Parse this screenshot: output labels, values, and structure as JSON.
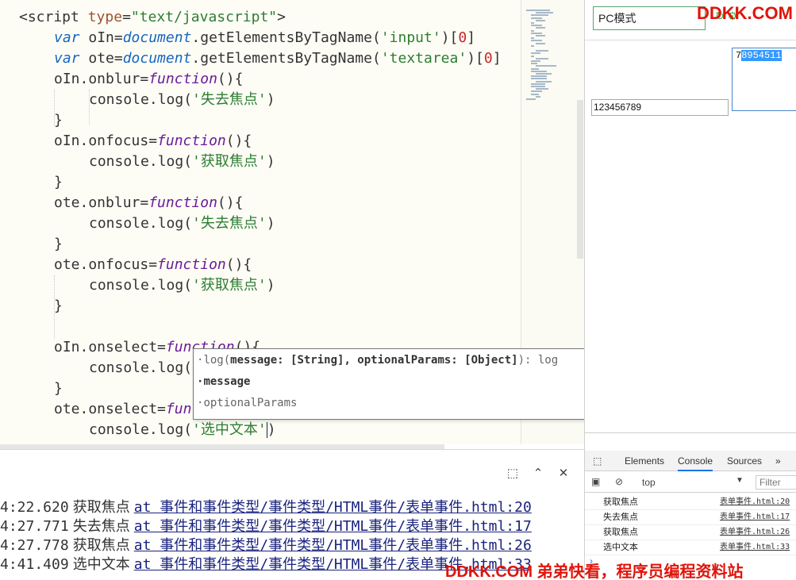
{
  "editor": {
    "lines": [
      [
        [
          "tag",
          "<script "
        ],
        [
          "attr",
          "type"
        ],
        [
          "tag",
          "="
        ],
        [
          "str",
          "\"text/javascript\""
        ],
        [
          "tag",
          ">"
        ]
      ],
      [
        [
          "var",
          "var"
        ],
        [
          "id",
          " oIn="
        ],
        [
          "obj",
          "document"
        ],
        [
          "id",
          ".getElementsByTagName("
        ],
        [
          "str",
          "'input'"
        ],
        [
          "id",
          ")["
        ],
        [
          "num",
          "0"
        ],
        [
          "id",
          "]"
        ]
      ],
      [
        [
          "var",
          "var"
        ],
        [
          "id",
          " ote="
        ],
        [
          "obj",
          "document"
        ],
        [
          "id",
          ".getElementsByTagName("
        ],
        [
          "str",
          "'textarea'"
        ],
        [
          "id",
          ")["
        ],
        [
          "num",
          "0"
        ],
        [
          "id",
          "]"
        ]
      ],
      [
        [
          "id",
          "oIn.onblur="
        ],
        [
          "fn",
          "function"
        ],
        [
          "id",
          "(){"
        ]
      ],
      [
        [
          "id",
          "console.log("
        ],
        [
          "str",
          "'失去焦点'"
        ],
        [
          "id",
          ")"
        ]
      ],
      [
        [
          "id",
          "}"
        ]
      ],
      [
        [
          "id",
          "oIn.onfocus="
        ],
        [
          "fn",
          "function"
        ],
        [
          "id",
          "(){"
        ]
      ],
      [
        [
          "id",
          "console.log("
        ],
        [
          "str",
          "'获取焦点'"
        ],
        [
          "id",
          ")"
        ]
      ],
      [
        [
          "id",
          "}"
        ]
      ],
      [
        [
          "id",
          "ote.onblur="
        ],
        [
          "fn",
          "function"
        ],
        [
          "id",
          "(){"
        ]
      ],
      [
        [
          "id",
          "console.log("
        ],
        [
          "str",
          "'失去焦点'"
        ],
        [
          "id",
          ")"
        ]
      ],
      [
        [
          "id",
          "}"
        ]
      ],
      [
        [
          "id",
          "ote.onfocus="
        ],
        [
          "fn",
          "function"
        ],
        [
          "id",
          "(){"
        ]
      ],
      [
        [
          "id",
          "console.log("
        ],
        [
          "str",
          "'获取焦点'"
        ],
        [
          "id",
          ")"
        ]
      ],
      [
        [
          "id",
          "}"
        ]
      ],
      [],
      [
        [
          "id",
          "oIn.onselect="
        ],
        [
          "fn",
          "function"
        ],
        [
          "id",
          "(){"
        ]
      ],
      [
        [
          "id",
          "console.log("
        ]
      ],
      [
        [
          "id",
          "}"
        ]
      ],
      [
        [
          "id",
          "ote.onselect="
        ],
        [
          "fn",
          "fun"
        ]
      ],
      [
        [
          "id",
          "console.log("
        ],
        [
          "str",
          "'选中文本'"
        ],
        [
          "caret",
          ""
        ],
        [
          "id",
          ")"
        ]
      ]
    ]
  },
  "autocomplete": {
    "signature_fn": "log(",
    "signature_params": "message: [String], optionalParams: [Object]",
    "signature_ret": "): log",
    "param_1": "message",
    "param_2": "optionalParams"
  },
  "bottom_console": {
    "logs": [
      {
        "time": "4:22.620",
        "message": "获取焦点",
        "source": "at 事件和事件类型/事件类型/HTML事件/表单事件.html:20"
      },
      {
        "time": "4:27.771",
        "message": "失去焦点",
        "source": "at 事件和事件类型/事件类型/HTML事件/表单事件.html:17"
      },
      {
        "time": "4:27.778",
        "message": "获取焦点",
        "source": "at 事件和事件类型/事件类型/HTML事件/表单事件.html:26"
      },
      {
        "time": "4:41.409",
        "message": "选中文本",
        "source": "at 事件和事件类型/事件类型/HTML事件/表单事件.html:33"
      }
    ]
  },
  "preview": {
    "mode_select": "PC模式",
    "textarea_prefix": "7",
    "textarea_selected": "8954511",
    "input_value": "123456789"
  },
  "devtools": {
    "tabs": [
      "Elements",
      "Console",
      "Sources"
    ],
    "more": "»",
    "context": "top",
    "filter_placeholder": "Filter",
    "filter_prefix": "F",
    "logs": [
      {
        "message": "获取焦点",
        "source": "表单事件.html:20"
      },
      {
        "message": "失去焦点",
        "source": "表单事件.html:17"
      },
      {
        "message": "获取焦点",
        "source": "表单事件.html:26"
      },
      {
        "message": "选中文本",
        "source": "表单事件.html:33"
      }
    ],
    "prompt": "›"
  },
  "watermarks": {
    "top": "DDKK.COM",
    "bottom": "DDKK.COM 弟弟快看，程序员编程资料站"
  },
  "colors": {
    "string": "#2e7d32",
    "keyword": "#1565c0",
    "function_kw": "#6a1b9a",
    "number": "#c62828",
    "watermark": "#e0140a"
  }
}
